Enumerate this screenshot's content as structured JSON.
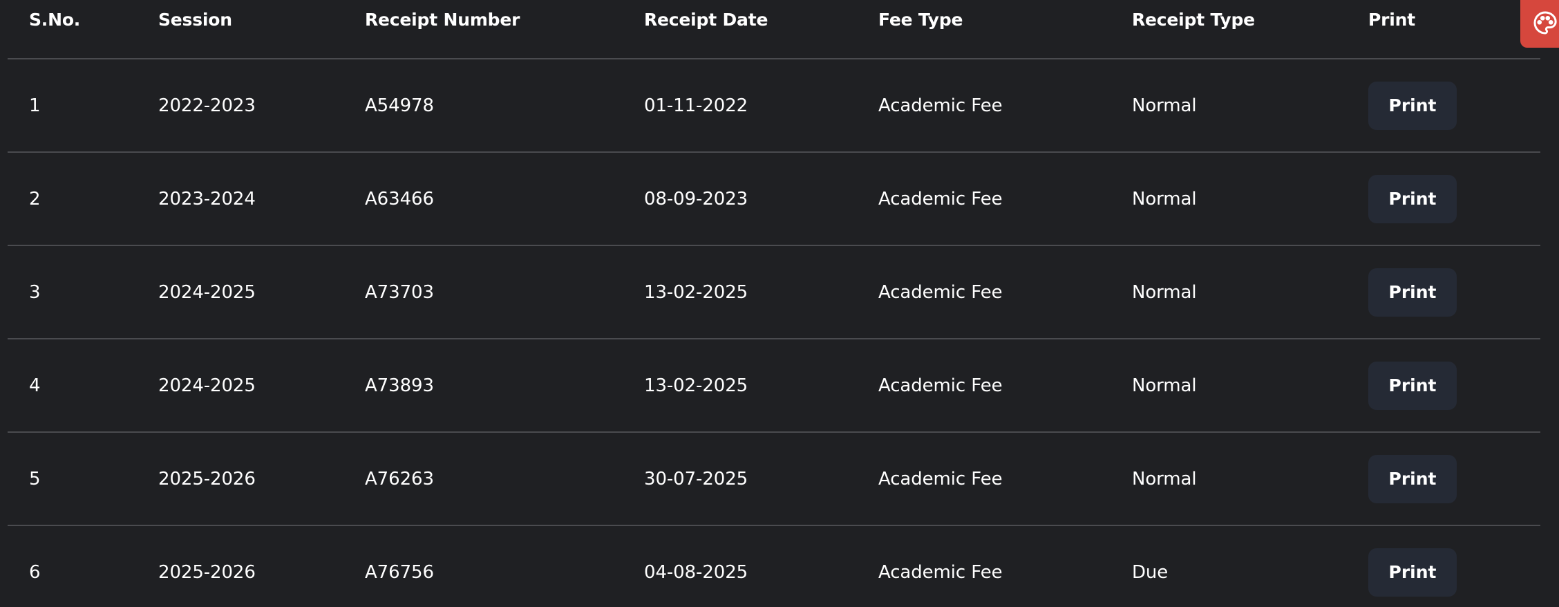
{
  "table": {
    "headers": [
      "S.No.",
      "Session",
      "Receipt Number",
      "Receipt Date",
      "Fee Type",
      "Receipt Type",
      "Print"
    ],
    "rows": [
      {
        "sno": "1",
        "session": "2022-2023",
        "receipt_number": "A54978",
        "receipt_date": "01-11-2022",
        "fee_type": "Academic Fee",
        "receipt_type": "Normal",
        "print_label": "Print"
      },
      {
        "sno": "2",
        "session": "2023-2024",
        "receipt_number": "A63466",
        "receipt_date": "08-09-2023",
        "fee_type": "Academic Fee",
        "receipt_type": "Normal",
        "print_label": "Print"
      },
      {
        "sno": "3",
        "session": "2024-2025",
        "receipt_number": "A73703",
        "receipt_date": "13-02-2025",
        "fee_type": "Academic Fee",
        "receipt_type": "Normal",
        "print_label": "Print"
      },
      {
        "sno": "4",
        "session": "2024-2025",
        "receipt_number": "A73893",
        "receipt_date": "13-02-2025",
        "fee_type": "Academic Fee",
        "receipt_type": "Normal",
        "print_label": "Print"
      },
      {
        "sno": "5",
        "session": "2025-2026",
        "receipt_number": "A76263",
        "receipt_date": "30-07-2025",
        "fee_type": "Academic Fee",
        "receipt_type": "Normal",
        "print_label": "Print"
      },
      {
        "sno": "6",
        "session": "2025-2026",
        "receipt_number": "A76756",
        "receipt_date": "04-08-2025",
        "fee_type": "Academic Fee",
        "receipt_type": "Due",
        "print_label": "Print"
      }
    ]
  },
  "theme_button": {
    "icon": "palette-icon",
    "color": "#d6473d"
  },
  "colors": {
    "background": "#1f2023",
    "button": "#252a35",
    "divider": "#4a4b4f"
  }
}
